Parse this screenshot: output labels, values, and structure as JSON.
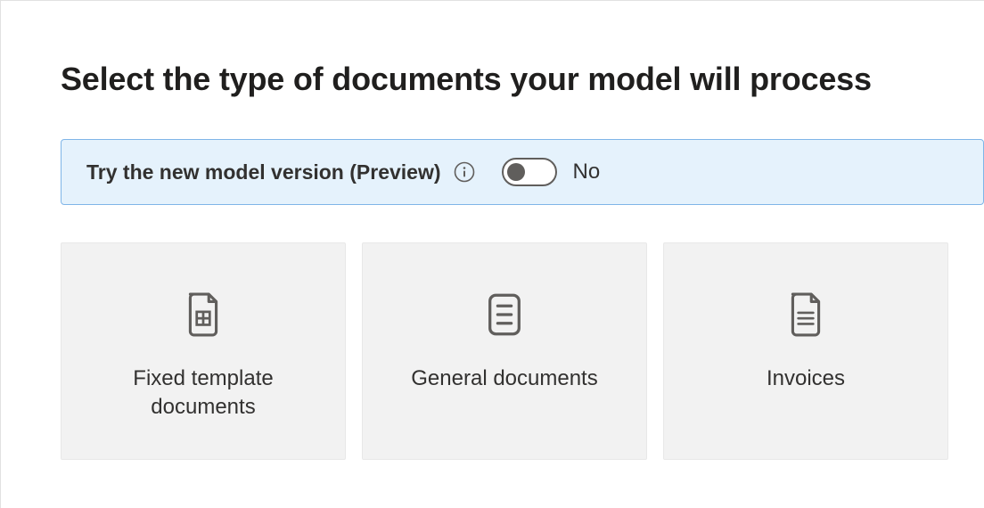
{
  "page": {
    "title": "Select the type of documents your model will process"
  },
  "preview_banner": {
    "label": "Try the new model version (Preview)",
    "toggle_state": "No"
  },
  "cards": [
    {
      "title": "Fixed template documents"
    },
    {
      "title": "General documents"
    },
    {
      "title": "Invoices"
    }
  ]
}
